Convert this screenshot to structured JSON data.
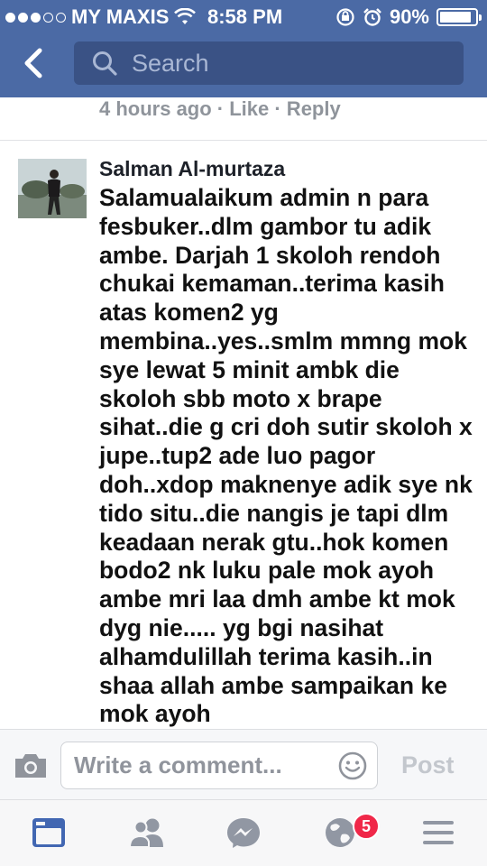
{
  "status_bar": {
    "carrier": "MY MAXIS",
    "time": "8:58 PM",
    "battery": "90%",
    "battery_level": 0.9,
    "signal_bars_filled": 3,
    "signal_bars_total": 5
  },
  "search": {
    "placeholder": "Search"
  },
  "previous_comment": {
    "meta": "4 hours ago · Like · Reply"
  },
  "comment": {
    "author": "Salman Al-murtaza",
    "text": "Salamualaikum admin n para fesbuker..dlm gambor tu adik ambe. Darjah 1 skoloh rendoh chukai kemaman..terima kasih atas komen2 yg membina..yes..smlm mmng mok sye lewat 5 minit ambk die skoloh sbb moto x brape sihat..die g cri doh sutir skoloh x jupe..tup2 ade luo pagor doh..xdop maknenye adik sye nk tido situ..die nangis je tapi dlm keadaan nerak gtu..hok komen bodo2 nk luku pale mok ayoh ambe mri laa dmh ambe kt mok dyg nie..... yg bgi nasihat alhamdulillah terima kasih..in shaa allah ambe sampaikan ke mok ayoh"
  },
  "composer": {
    "placeholder": "Write a comment...",
    "post_label": "Post"
  },
  "tabbar": {
    "items": [
      {
        "icon": "news-feed-icon",
        "active": true
      },
      {
        "icon": "friends-icon",
        "active": false
      },
      {
        "icon": "messenger-icon",
        "active": false
      },
      {
        "icon": "notifications-globe-icon",
        "active": false
      },
      {
        "icon": "menu-icon",
        "active": false
      }
    ],
    "notification_badge": "5"
  },
  "colors": {
    "header_blue": "#4b6aa5",
    "search_bar": "#3a5285",
    "active_tab": "#4267b2",
    "inactive_tab": "#9197a3",
    "badge": "#f02849"
  }
}
